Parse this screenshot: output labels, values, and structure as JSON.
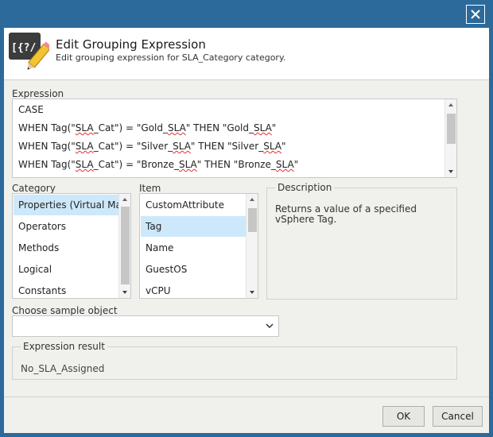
{
  "window": {
    "close_glyph": "close-icon"
  },
  "header": {
    "icon": "expression-edit-icon",
    "icon_text": "[{?/",
    "title": "Edit Grouping Expression",
    "subtitle": "Edit grouping expression for SLA_Category category."
  },
  "expression": {
    "label": "Expression",
    "lines": [
      "CASE",
      "WHEN Tag(\"SLA_Cat\") = \"Gold_SLA\" THEN \"Gold_SLA\"",
      "WHEN Tag(\"SLA_Cat\") = \"Silver_SLA\" THEN \"Silver_SLA\"",
      "WHEN Tag(\"SLA_Cat\") = \"Bronze_SLA\" THEN \"Bronze_SLA\""
    ]
  },
  "category": {
    "label": "Category",
    "items": [
      "Properties (Virtual Machine)",
      "Operators",
      "Methods",
      "Logical",
      "Constants"
    ],
    "selected_index": 0
  },
  "item": {
    "label": "Item",
    "items": [
      "CustomAttribute",
      "Tag",
      "Name",
      "GuestOS",
      "vCPU"
    ],
    "selected_index": 1
  },
  "description": {
    "label": "Description",
    "text": "Returns a value of a specified vSphere Tag."
  },
  "sample_object": {
    "label": "Choose sample object",
    "value": ""
  },
  "result": {
    "label": "Expression result",
    "value": "No_SLA_Assigned"
  },
  "buttons": {
    "ok": "OK",
    "cancel": "Cancel"
  },
  "colors": {
    "window_border": "#2b6a9b",
    "selection": "#cde8fa",
    "dialog_bg": "#f0f0ec"
  }
}
